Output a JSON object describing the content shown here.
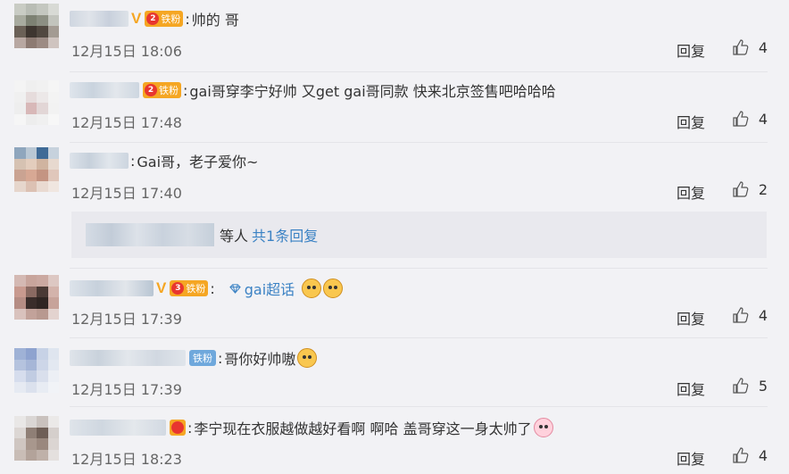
{
  "comments": [
    {
      "verified": "V",
      "fan_level": "2",
      "fan_badge": "铁粉",
      "colon": ":",
      "text": "帅的 哥",
      "time": "12月15日 18:06",
      "reply_label": "回复",
      "likes": "4"
    },
    {
      "fan_level": "2",
      "fan_badge": "铁粉",
      "colon": ":",
      "text": "gai哥穿李宁好帅 又get gai哥同款 快来北京签售吧哈哈哈",
      "time": "12月15日 17:48",
      "reply_label": "回复",
      "likes": "4"
    },
    {
      "colon": ":",
      "text": "Gai哥，老子爱你~",
      "time": "12月15日 17:40",
      "reply_label": "回复",
      "likes": "2",
      "sub_reply": {
        "suffix": "等人",
        "link": "共1条回复"
      }
    },
    {
      "verified": "V",
      "fan_level": "3",
      "fan_badge": "铁粉",
      "colon": ":",
      "topic": "gai超话",
      "time": "12月15日 17:39",
      "reply_label": "回复",
      "likes": "4"
    },
    {
      "fan_badge": "铁粉",
      "colon": ":",
      "text": "哥你好帅嗷",
      "time": "12月15日 17:39",
      "reply_label": "回复",
      "likes": "5"
    },
    {
      "colon": ":",
      "text": "李宁现在衣服越做越好看啊 啊哈   盖哥穿这一身太帅了",
      "time": "12月15日 18:23",
      "reply_label": "回复",
      "likes": "4"
    }
  ],
  "colors": {
    "background": "#f2f2f5",
    "link": "#3b82c4",
    "verified": "#f5a623",
    "fan_badge": "#f5a623"
  }
}
